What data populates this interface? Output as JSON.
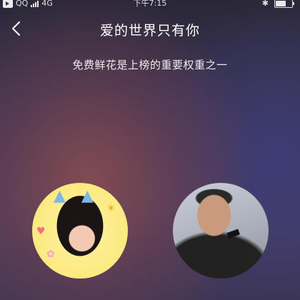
{
  "status_bar": {
    "carrier": "QQ",
    "network": "4G",
    "time": "下午7:15",
    "bluetooth_icon": "bluetooth-icon",
    "battery_icon": "battery-icon"
  },
  "header": {
    "title": "爱的世界只有你",
    "back_icon": "chevron-left-icon"
  },
  "main": {
    "subtitle": "免费鲜花是上榜的重要权重之一"
  },
  "avatars": {
    "left_icon": "avatar-female-icon",
    "right_icon": "avatar-male-icon"
  }
}
